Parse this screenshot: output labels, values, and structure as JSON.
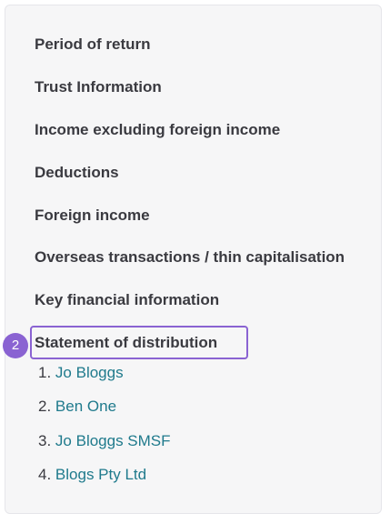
{
  "nav": {
    "items": [
      "Period of return",
      "Trust Information",
      "Income excluding foreign income",
      "Deductions",
      "Foreign income",
      "Overseas transactions / thin capitalisation",
      "Key financial information",
      "Statement of distribution"
    ]
  },
  "step_badge": "2",
  "distribution": {
    "beneficiaries": [
      {
        "num": "1.",
        "name": "Jo Bloggs"
      },
      {
        "num": "2.",
        "name": "Ben One"
      },
      {
        "num": "3.",
        "name": "Jo Bloggs SMSF"
      },
      {
        "num": "4.",
        "name": "Blogs Pty Ltd"
      }
    ]
  },
  "colors": {
    "highlight": "#8a63d2",
    "link": "#1f7a8c",
    "text": "#3a3a40"
  }
}
